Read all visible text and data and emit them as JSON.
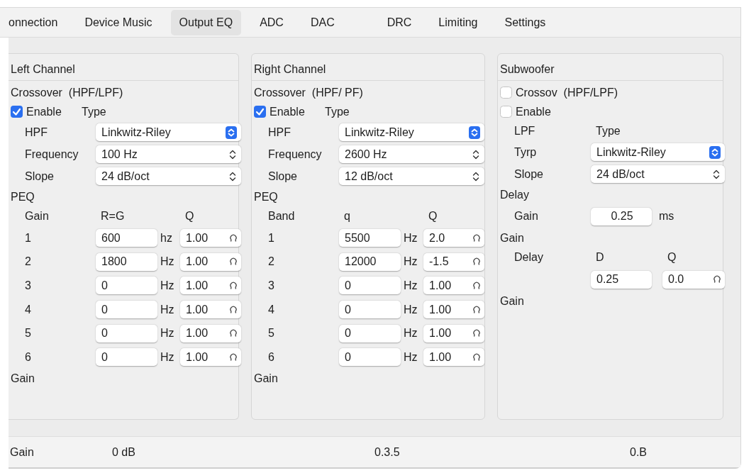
{
  "tabs": [
    {
      "label": "onnection",
      "selected": false
    },
    {
      "label": "Device Music",
      "selected": false
    },
    {
      "label": "Output EQ",
      "selected": true
    },
    {
      "label": "ADC",
      "selected": false
    },
    {
      "label": "DAC",
      "selected": false
    },
    {
      "label": "DRC",
      "selected": false
    },
    {
      "label": "Limiting",
      "selected": false
    },
    {
      "label": "Settings",
      "selected": false
    }
  ],
  "panels": [
    {
      "title": "Left Channel",
      "items": [
        {
          "kind": "heading",
          "text": "Crossover  (HPF/LPF)"
        },
        {
          "kind": "check",
          "label": "Enable",
          "checked": true,
          "aside": "Type"
        },
        {
          "kind": "select",
          "label": "HPF",
          "value": "Linkwitz-Riley",
          "accent": true
        },
        {
          "kind": "select",
          "label": "Frequency",
          "value": "100 Hz",
          "accent": false
        },
        {
          "kind": "select",
          "label": "Slope",
          "value": "24 dB/oct",
          "accent": false
        },
        {
          "kind": "heading",
          "text": "PEQ"
        },
        {
          "kind": "labels",
          "cells": [
            "Gain",
            "R=G",
            "Q"
          ]
        },
        {
          "kind": "band",
          "label": "1",
          "freq": "600",
          "unit": "hz",
          "q": "1.00"
        },
        {
          "kind": "band",
          "label": "2",
          "freq": "1800",
          "unit": "Hz",
          "q": "1.00"
        },
        {
          "kind": "band",
          "label": "3",
          "freq": "0",
          "unit": "Hz",
          "q": "1.00"
        },
        {
          "kind": "band",
          "label": "4",
          "freq": "0",
          "unit": "Hz",
          "q": "1.00"
        },
        {
          "kind": "band",
          "label": "5",
          "freq": "0",
          "unit": "Hz",
          "q": "1.00"
        },
        {
          "kind": "band",
          "label": "6",
          "freq": "0",
          "unit": "Hz",
          "q": "1.00"
        },
        {
          "kind": "heading",
          "text": "Gain"
        }
      ]
    },
    {
      "title": "Right Channel",
      "items": [
        {
          "kind": "heading",
          "text": "Crossover  (HPF/ PF)"
        },
        {
          "kind": "check",
          "label": "Enable",
          "checked": true,
          "aside": "Type"
        },
        {
          "kind": "select",
          "label": "HPF",
          "value": "Linkwitz-Riley",
          "accent": true
        },
        {
          "kind": "select",
          "label": "Frequency",
          "value": "2600 Hz",
          "accent": false
        },
        {
          "kind": "select",
          "label": "Slope",
          "value": "12 dB/oct",
          "accent": false
        },
        {
          "kind": "heading",
          "text": "PEQ"
        },
        {
          "kind": "labels",
          "cells": [
            "Band",
            "q",
            "Q"
          ]
        },
        {
          "kind": "band",
          "label": "1",
          "freq": "5500",
          "unit": "Hz",
          "q": "2.0"
        },
        {
          "kind": "band",
          "label": "2",
          "freq": "12000",
          "unit": "Hz",
          "q": "-1.5"
        },
        {
          "kind": "band",
          "label": "3",
          "freq": "0",
          "unit": "Hz",
          "q": "1.00"
        },
        {
          "kind": "band",
          "label": "4",
          "freq": "0",
          "unit": "Hz",
          "q": "1.00"
        },
        {
          "kind": "band",
          "label": "5",
          "freq": "0",
          "unit": "Hz",
          "q": "1.00"
        },
        {
          "kind": "band",
          "label": "6",
          "freq": "0",
          "unit": "Hz",
          "q": "1.00"
        },
        {
          "kind": "heading",
          "text": "Gain"
        }
      ]
    },
    {
      "title": "Subwoofer",
      "items": [
        {
          "kind": "check",
          "label": "Crossov  (HPF/LPF)",
          "checked": false
        },
        {
          "kind": "check",
          "label": "Enable",
          "checked": false
        },
        {
          "kind": "labels",
          "cells": [
            "LPF",
            "Type"
          ]
        },
        {
          "kind": "select",
          "label": "Tyrp",
          "value": "Linkwitz-Riley",
          "accent": true
        },
        {
          "kind": "select",
          "label": "Slope",
          "value": "24 dB/oct",
          "accent": false
        },
        {
          "kind": "heading",
          "text": "Delay"
        },
        {
          "kind": "delay",
          "label": "Gain",
          "value": "0.25",
          "unit": "ms"
        },
        {
          "kind": "heading",
          "text": "Gain"
        },
        {
          "kind": "labels",
          "cells": [
            "Delay",
            "D",
            "Q"
          ]
        },
        {
          "kind": "pair",
          "value": "0.25",
          "q": "0.0"
        },
        {
          "kind": "heading",
          "text": "Gain"
        }
      ]
    }
  ],
  "status_bar": [
    {
      "text": "Gain"
    },
    {
      "text": "0 dB"
    },
    {
      "text": "0.3.5"
    },
    {
      "text": "0.B"
    }
  ]
}
